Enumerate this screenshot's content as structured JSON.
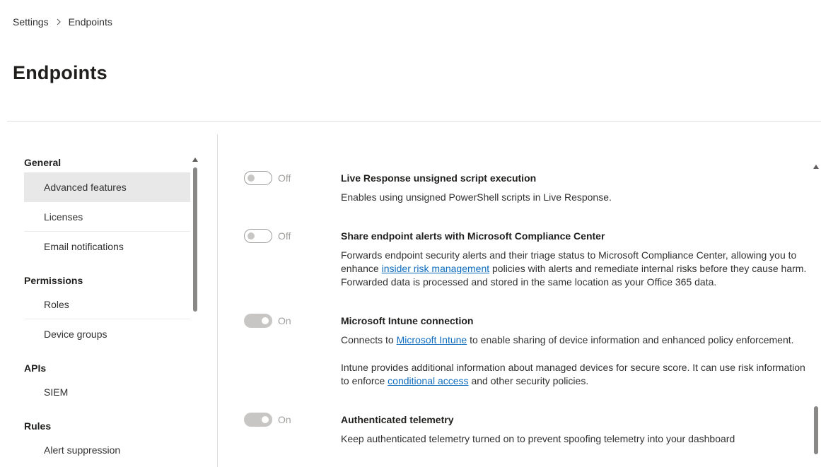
{
  "breadcrumb": {
    "items": [
      "Settings",
      "Endpoints"
    ]
  },
  "page": {
    "title": "Endpoints"
  },
  "nav": {
    "groups": [
      {
        "label": "General",
        "items": [
          "Advanced features",
          "Licenses",
          "Email notifications"
        ]
      },
      {
        "label": "Permissions",
        "items": [
          "Roles",
          "Device groups"
        ]
      },
      {
        "label": "APIs",
        "items": [
          "SIEM"
        ]
      },
      {
        "label": "Rules",
        "items": [
          "Alert suppression"
        ]
      }
    ],
    "selected": "Advanced features"
  },
  "features": [
    {
      "state": "Off",
      "title": "Live Response unsigned script execution",
      "desc": "Enables using unsigned PowerShell scripts in Live Response."
    },
    {
      "state": "Off",
      "title": "Share endpoint alerts with Microsoft Compliance Center",
      "desc_before": "Forwards endpoint security alerts and their triage status to Microsoft Compliance Center, allowing you to enhance ",
      "desc_link": "insider risk management",
      "desc_after": " policies with alerts and remediate internal risks before they cause harm. Forwarded data is processed and stored in the same location as your Office 365 data."
    },
    {
      "state": "On",
      "title": "Microsoft Intune connection",
      "desc_before": "Connects to ",
      "desc_link": "Microsoft Intune",
      "desc_after": " to enable sharing of device information and enhanced policy enforcement.",
      "desc2_before": "Intune provides additional information about managed devices for secure score. It can use risk information to enforce ",
      "desc2_link": "conditional access",
      "desc2_after": " and other security policies."
    },
    {
      "state": "On",
      "title": "Authenticated telemetry",
      "desc": "Keep authenticated telemetry turned on to prevent spoofing telemetry into your dashboard"
    }
  ]
}
